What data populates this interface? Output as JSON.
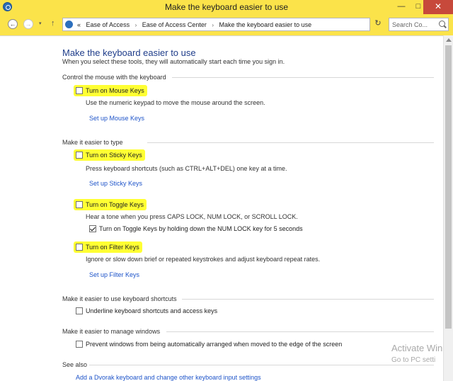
{
  "window": {
    "title": "Make the keyboard easier to use",
    "minimize_glyph": "—",
    "maximize_glyph": "□",
    "close_glyph": "✕",
    "accent_color": "#fbe34a"
  },
  "toolbar": {
    "back_glyph": "←",
    "forward_glyph": "→",
    "recent_glyph": "▾",
    "up_glyph": "↑",
    "breadcrumb_prefix": "«",
    "breadcrumb": [
      "Ease of Access",
      "Ease of Access Center",
      "Make the keyboard easier to use"
    ],
    "breadcrumb_separator": "›",
    "address_dropdown_glyph": "▾",
    "refresh_glyph": "↻",
    "search_placeholder": "Search Co..."
  },
  "page": {
    "title": "Make the keyboard easier to use",
    "intro": "When you select these tools, they will automatically start each time you sign in."
  },
  "sections": {
    "mouse": {
      "heading": "Control the mouse with the keyboard",
      "mouse_keys_label": "Turn on Mouse Keys",
      "mouse_keys_checked": false,
      "mouse_keys_desc": "Use the numeric keypad to move the mouse around the screen.",
      "setup_link": "Set up Mouse Keys"
    },
    "typing": {
      "heading": "Make it easier to type",
      "sticky_label": "Turn on Sticky Keys",
      "sticky_checked": false,
      "sticky_desc": "Press keyboard shortcuts (such as CTRL+ALT+DEL) one key at a time.",
      "sticky_link": "Set up Sticky Keys",
      "toggle_label": "Turn on Toggle Keys",
      "toggle_checked": false,
      "toggle_desc": "Hear a tone when you press CAPS LOCK, NUM LOCK, or SCROLL LOCK.",
      "toggle_hold_label": "Turn on Toggle Keys by holding down the NUM LOCK key for 5 seconds",
      "toggle_hold_checked": true,
      "filter_label": "Turn on Filter Keys",
      "filter_checked": false,
      "filter_desc": "Ignore or slow down brief or repeated keystrokes and adjust keyboard repeat rates.",
      "filter_link": "Set up Filter Keys"
    },
    "shortcuts": {
      "heading": "Make it easier to use keyboard shortcuts",
      "underline_label": "Underline keyboard shortcuts and access keys",
      "underline_checked": false
    },
    "windows": {
      "heading": "Make it easier to manage windows",
      "prevent_label": "Prevent windows from being automatically arranged when moved to the edge of the screen",
      "prevent_checked": false
    },
    "see_also": {
      "heading": "See also",
      "dvorak_link": "Add a Dvorak keyboard and change other keyboard input settings"
    }
  },
  "watermark": {
    "line1": "Activate Win",
    "line2": "Go to PC setti"
  },
  "highlight_color": "#ffff33"
}
